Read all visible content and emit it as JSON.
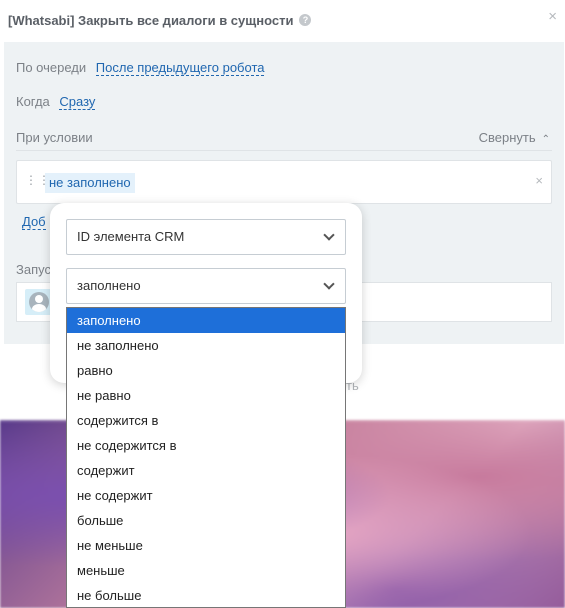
{
  "header": {
    "title": "[Whatsabi] Закрыть все диалоги в сущности",
    "help_icon": "?",
    "close_icon": "×"
  },
  "settings": {
    "order_label": "По очереди",
    "order_value": "После предыдущего робота",
    "when_label": "Когда",
    "when_value": "Сразу",
    "condition_label": "При условии",
    "collapse_label": "Свернуть",
    "collapse_icon": "⌃",
    "condition_tag": "не заполнено",
    "condition_close": "×",
    "add_partial": "Доб",
    "run_partial": "Запус"
  },
  "popup": {
    "field_select": "ID элемента CRM",
    "operator_select": "заполнено"
  },
  "dropdown": {
    "options": [
      "заполнено",
      "не заполнено",
      "равно",
      "не равно",
      "содержится в",
      "не содержится в",
      "содержит",
      "не содержит",
      "больше",
      "не меньше",
      "меньше",
      "не больше"
    ],
    "selected": "заполнено"
  },
  "colors": {
    "accent": "#2067b0",
    "selection": "#1e6fd9",
    "panel_bg": "#eef2f4"
  }
}
